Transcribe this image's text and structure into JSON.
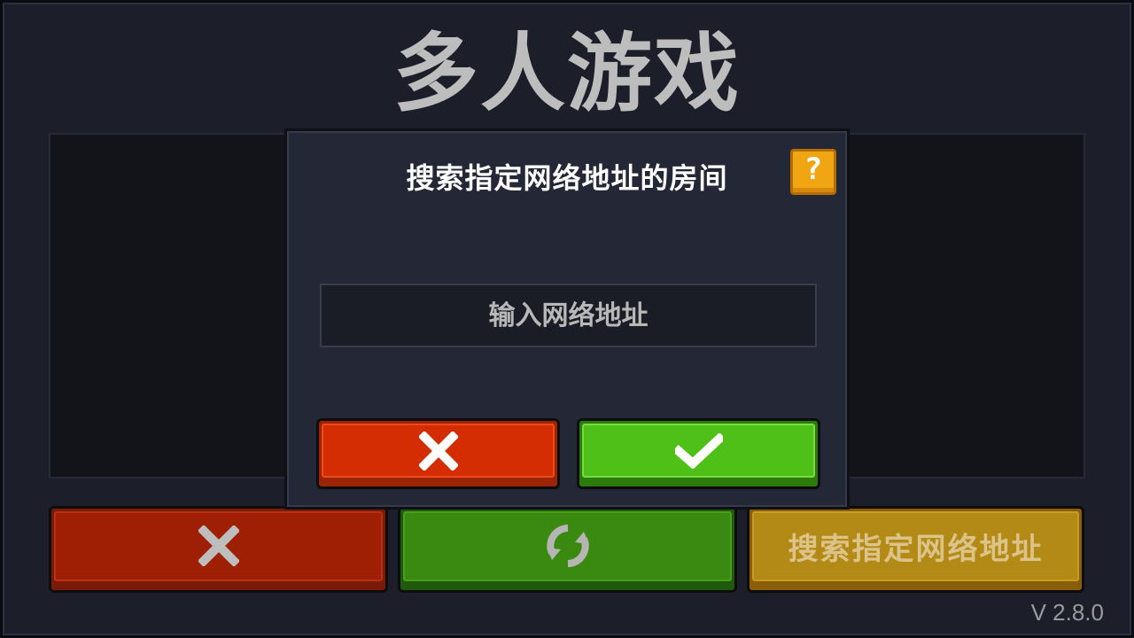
{
  "screen": {
    "title": "多人游戏",
    "version": "V 2.8.0"
  },
  "bottom_bar": {
    "back_icon": "close-x-icon",
    "refresh_icon": "refresh-icon",
    "search_address_label": "搜索指定网络地址"
  },
  "dialog": {
    "title": "搜索指定网络地址的房间",
    "help_label": "?",
    "address_placeholder": "输入网络地址",
    "address_value": "",
    "cancel_icon": "close-x-icon",
    "confirm_icon": "checkmark-icon"
  },
  "colors": {
    "background": "#1c1f2a",
    "back_button": "#9f1f04",
    "refresh_button": "#3a8a12",
    "search_button": "#b38a15",
    "dialog_cancel": "#d42d03",
    "dialog_confirm": "#4fc018",
    "help_button": "#f0a512"
  }
}
